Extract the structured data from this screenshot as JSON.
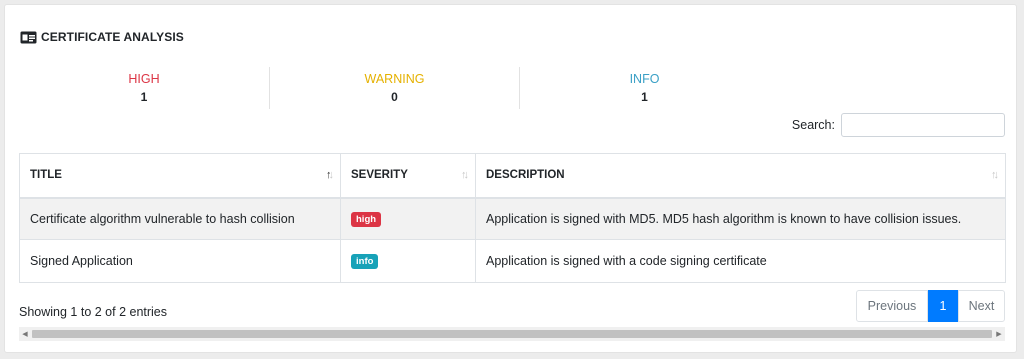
{
  "section": {
    "title": "CERTIFICATE ANALYSIS",
    "icon": "id-card-icon"
  },
  "stats": [
    {
      "label": "HIGH",
      "value": "1",
      "color": "#dc3545"
    },
    {
      "label": "WARNING",
      "value": "0",
      "color": "#e5b100"
    },
    {
      "label": "INFO",
      "value": "1",
      "color": "#3aa0c6"
    }
  ],
  "search": {
    "label": "Search:",
    "value": "",
    "placeholder": ""
  },
  "table": {
    "columns": [
      "TITLE",
      "SEVERITY",
      "DESCRIPTION"
    ],
    "rows": [
      {
        "title": "Certificate algorithm vulnerable to hash collision",
        "severity": "high",
        "description": "Application is signed with MD5. MD5 hash algorithm is known to have collision issues."
      },
      {
        "title": "Signed Application",
        "severity": "info",
        "description": "Application is signed with a code signing certificate"
      }
    ]
  },
  "footer": {
    "showing": "Showing 1 to 2 of 2 entries",
    "previous": "Previous",
    "current_page": "1",
    "next": "Next"
  },
  "colors": {
    "high": "#dc3545",
    "info": "#17a2b8",
    "accent": "#007bff"
  }
}
